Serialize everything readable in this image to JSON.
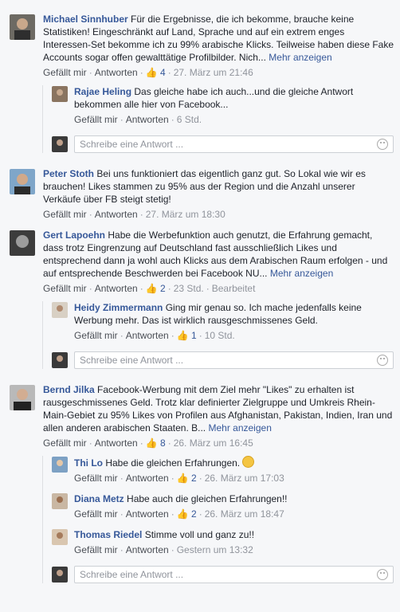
{
  "labels": {
    "like": "Gefällt mir",
    "reply": "Antworten",
    "sep": "·",
    "more": "Mehr anzeigen",
    "edited": "Bearbeitet",
    "write_placeholder": "Schreibe eine Antwort ..."
  },
  "c1": {
    "name": "Michael Sinnhuber",
    "text": "Für die Ergebnisse, die ich bekomme, brauche keine Statistiken! Eingeschränkt auf Land, Sprache und auf ein extrem enges Interessen-Set bekomme ich zu 99% arabische Klicks. Teilweise haben diese Fake Accounts sogar offen gewalttätige Profilbilder. Nich...",
    "likes": "4",
    "time": "27. März um 21:46",
    "r1": {
      "name": "Rajae Heling",
      "text": "Das gleiche habe ich auch...und die gleiche Antwort bekommen alle hier von Facebook...",
      "time": "6 Std."
    }
  },
  "c2": {
    "name": "Peter Stoth",
    "text": "Bei uns funktioniert das eigentlich ganz gut. So Lokal wie wir es brauchen! Likes stammen zu 95% aus der Region und die Anzahl unserer Verkäufe über FB steigt stetig!",
    "time": "27. März um 18:30"
  },
  "c3": {
    "name": "Gert Lapoehn",
    "text": "Habe die Werbefunktion auch genutzt, die Erfahrung gemacht, dass trotz Eingrenzung auf Deutschland fast ausschließlich Likes und entsprechend dann ja wohl auch Klicks aus dem Arabischen Raum erfolgen - und auf entsprechende Beschwerden bei Facebook NU...",
    "likes": "2",
    "time": "23 Std.",
    "r1": {
      "name": "Heidy Zimmermann",
      "text": "Ging mir genau so. Ich mache jedenfalls keine Werbung mehr. Das ist wirklich rausgeschmissenes Geld.",
      "likes": "1",
      "time": "10 Std."
    }
  },
  "c4": {
    "name": "Bernd Jilka",
    "text": "Facebook-Werbung mit dem Ziel mehr \"Likes\" zu erhalten ist rausgeschmissenes Geld. Trotz klar definierter Zielgruppe und Umkreis Rhein-Main-Gebiet zu 95% Likes von Profilen aus Afghanistan, Pakistan, Indien, Iran und allen anderen arabischen Staaten. B...",
    "likes": "8",
    "time": "26. März um 16:45",
    "r1": {
      "name": "Thi Lo",
      "text": "Habe die gleichen Erfahrungen.",
      "likes": "2",
      "time": "26. März um 17:03"
    },
    "r2": {
      "name": "Diana Metz",
      "text": "Habe auch die gleichen Erfahrungen!!",
      "likes": "2",
      "time": "26. März um 18:47"
    },
    "r3": {
      "name": "Thomas Riedel",
      "text": "Stimme voll und ganz zu!!",
      "time": "Gestern um 13:32"
    }
  }
}
